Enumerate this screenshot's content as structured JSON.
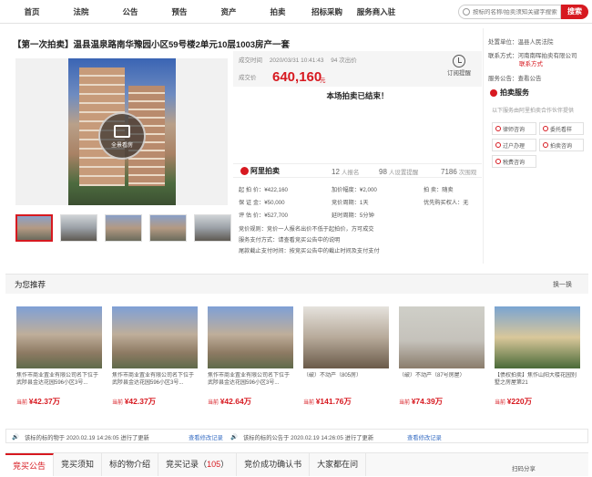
{
  "nav": {
    "items": [
      "首页",
      "法院",
      "公告",
      "预告",
      "资产",
      "拍卖",
      "招标采购",
      "服务商入驻"
    ],
    "search_placeholder": "按标的名称/拍卖须知关键字搜索",
    "search_button": "搜索"
  },
  "auction": {
    "title": "【第一次拍卖】温县温泉路南华豫园小区59号楼2单元10层1003房产一套",
    "pano_label": "全景看房",
    "end_time_label": "成交时间",
    "end_time_value": "2020/03/31 10:41:43",
    "end_time_extra": "94 次出价",
    "price_label": "成交价",
    "price_value": "640,160",
    "price_unit": "元",
    "remind_label": "订阅提醒",
    "ended_text": "本场拍卖已结束！",
    "platform": "阿里拍卖",
    "stats": [
      {
        "num": "12",
        "label": "人报名"
      },
      {
        "num": "98",
        "label": "人设置提醒"
      },
      {
        "num": "7186",
        "label": "次围观"
      }
    ],
    "details_col1": [
      "起 拍 价：¥422,160",
      "保 证 金：¥50,000",
      "评 估 价：¥527,700"
    ],
    "details_col2": [
      "加价幅度：¥2,000",
      "竞价周期：1天",
      "延时周期：5分钟"
    ],
    "details_col3": [
      "拍    卖：随卖",
      "",
      "优先购买权人：无"
    ],
    "notes": [
      "竞价规则：竞价一人报名出价不低于起拍价，方可成交",
      "服务支付方式：请查看竞买公告中的说明",
      "尾款截止支付时间：按竞买公告中的截止时间及支付支付"
    ]
  },
  "right_panel": {
    "court_label": "处置单位：温县人民法院",
    "contact_label": "联系方式：河南南晖拍卖有限公司",
    "contact_sub": "联系方式",
    "watch_label": "服务公告：查看公告",
    "service_title": "拍卖服务",
    "service_sub": "以下服务由阿里拍卖合作伙伴提供",
    "services": [
      "律师咨询",
      "委托看样",
      "过户办理",
      "拍卖咨询",
      "税费咨询"
    ]
  },
  "recommend": {
    "title": "为您推荐",
    "refresh": "换一换",
    "items": [
      {
        "name": "焦作市商业置业有限公司名下位于武陟县金达花园596小区3号...",
        "prefix": "当前",
        "price": "¥42.37万"
      },
      {
        "name": "焦作市商业置业有限公司名下位于武陟县金达花园596小区3号...",
        "prefix": "当前",
        "price": "¥42.37万"
      },
      {
        "name": "焦作市商业置业有限公司名下位于武陟县金达花园596小区3号...",
        "prefix": "当前",
        "price": "¥42.64万"
      },
      {
        "name": "（破）不动产（805房）",
        "prefix": "当前",
        "price": "¥141.76万"
      },
      {
        "name": "（破）不动产（87号房屋）",
        "prefix": "当前",
        "price": "¥74.39万"
      },
      {
        "name": "【债权拍卖】焦作山阳大楼花园别墅之房屋第21",
        "prefix": "当前",
        "price": "¥220万"
      }
    ]
  },
  "notice": {
    "text1": "该标的标的物于 2020.02.19 14:26:05 进行了更新",
    "link1": "查看修改记录",
    "text2": "该标的标的公告于 2020.02.19 14:26:05 进行了更新",
    "link2": "查看修改记录"
  },
  "tabs": [
    {
      "label": "竞买公告",
      "count": ""
    },
    {
      "label": "竞买须知",
      "count": ""
    },
    {
      "label": "标的物介绍",
      "count": ""
    },
    {
      "label": "竞买记录",
      "count": "105"
    },
    {
      "label": "竞价成功确认书",
      "count": ""
    },
    {
      "label": "大家都在问",
      "count": ""
    }
  ],
  "scan_label": "扫码分享"
}
